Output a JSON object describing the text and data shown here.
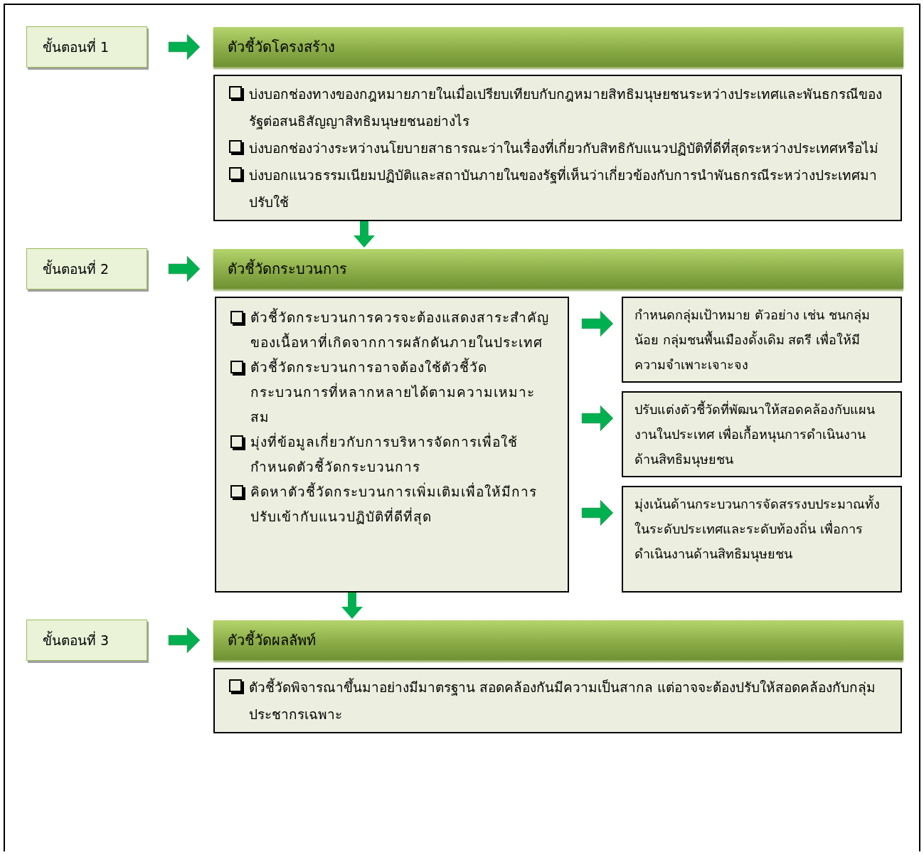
{
  "stages": [
    {
      "step_label": "ขั้นตอนที่ 1",
      "title": "ตัวชี้วัดโครงสร้าง",
      "items": [
        "บ่งบอกช่องทางของกฎหมายภายในเมื่อเปรียบเทียบกับกฎหมายสิทธิมนุษยชนระหว่างประเทศและพันธกรณีของรัฐต่อสนธิสัญญาสิทธิมนุษยชนอย่างไร",
        "บ่งบอกช่องว่างระหว่างนโยบายสาธารณะว่าในเรื่องที่เกี่ยวกับสิทธิกับแนวปฏิบัติที่ดีที่สุดระหว่างประเทศหรือไม่",
        "บ่งบอกแนวธรรมเนียมปฏิบัติและสถาบันภายในของรัฐที่เห็นว่าเกี่ยวข้องกับการนำพันธกรณีระหว่างประเทศมาปรับใช้"
      ]
    },
    {
      "step_label": "ขั้นตอนที่ 2",
      "title": "ตัวชี้วัดกระบวนการ",
      "items": [
        "ตัวชี้วัดกระบวนการควรจะต้องแสดงสาระสำคัญของเนื้อหาที่เกิดจากการผลักดันภายในประเทศ",
        "ตัวชี้วัดกระบวนการอาจต้องใช้ตัวชี้วัดกระบวนการที่หลากหลายได้ตามความเหมาะสม",
        "มุ่งที่ข้อมูลเกี่ยวกับการบริหารจัดการเพื่อใช้กำหนดตัวชี้วัดกระบวนการ",
        "คิดหาตัวชี้วัดกระบวนการเพิ่มเติมเพื่อให้มีการปรับเข้ากับแนวปฏิบัติที่ดีที่สุด"
      ],
      "side_notes": [
        "กำหนดกลุ่มเป้าหมาย ตัวอย่าง เช่น ชนกลุ่มน้อย กลุ่มชนพื้นเมืองดั้งเดิม สตรี เพื่อให้มีความจำเพาะเจาะจง",
        "ปรับแต่งตัวชี้วัดที่พัฒนาให้สอดคล้องกับแผนงานในประเทศ เพื่อเกื้อหนุนการดำเนินงานด้านสิทธิมนุษยชน",
        "มุ่งเน้นด้านกระบวนการจัดสรรงบประมาณทั้งในระดับประเทศและระดับท้องถิ่น เพื่อการดำเนินงานด้านสิทธิมนุษยชน"
      ]
    },
    {
      "step_label": "ขั้นตอนที่ 3",
      "title": "ตัวชี้วัดผลลัพท์",
      "items": [
        "ตัวชี้วัดพิจารณาขึ้นมาอย่างมีมาตรฐาน สอดคล้องกันมีความเป็นสากล แต่อาจจะต้องปรับให้สอดคล้องกับกลุ่มประชากรเฉพาะ"
      ]
    }
  ]
}
